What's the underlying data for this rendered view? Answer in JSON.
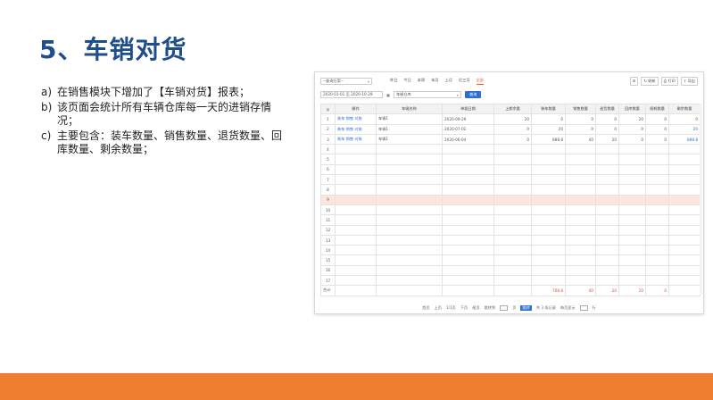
{
  "slide": {
    "title": "5、车销对货",
    "bullets": [
      {
        "marker": "a)",
        "text": "在销售模块下增加了【车销对货】报表；"
      },
      {
        "marker": "b)",
        "text": "该页面会统计所有车辆仓库每一天的进销存情况；"
      },
      {
        "marker": "c)",
        "text": "主要包含：装车数量、销售数量、退货数量、回库数量、剩余数量；"
      }
    ]
  },
  "app": {
    "query_scheme": "--查询方案--",
    "quick_ranges": [
      "昨日",
      "今日",
      "本周",
      "本月",
      "上月",
      "近三月",
      "全部"
    ],
    "active_range": "全部",
    "toolbar_buttons": [
      "刷新",
      "打印",
      "导出"
    ],
    "date_range": "2020-01-01 至 2020-10-29",
    "warehouse_placeholder": "车辆仓库",
    "query_button": "查询",
    "columns": [
      "",
      "操作",
      "车辆名称",
      "单据日期",
      "上期余量",
      "装车数量",
      "销售数量",
      "退货数量",
      "回库数量",
      "损耗数量",
      "剩余数量"
    ],
    "rows": [
      {
        "no": "1",
        "ops": "装车 销售 对账",
        "vehicle": "车辆1",
        "date": "2020-09-29",
        "prev": "20",
        "load": "0",
        "sale": "0",
        "ret": "0",
        "back": "20",
        "loss": "0",
        "left": "0",
        "left_link": false
      },
      {
        "no": "2",
        "ops": "装车 销售 对账",
        "vehicle": "车辆1",
        "date": "2020-07-02",
        "prev": "0",
        "load": "20",
        "sale": "0",
        "ret": "0",
        "back": "0",
        "loss": "0",
        "left": "20",
        "left_link": true
      },
      {
        "no": "3",
        "ops": "装车 销售 对账",
        "vehicle": "车辆1",
        "date": "2020-06-04",
        "prev": "0",
        "load": "888.8",
        "sale": "40",
        "ret": "20",
        "back": "0",
        "loss": "0",
        "left": "888.8",
        "left_link": true
      }
    ],
    "empty_rows": [
      "4",
      "5",
      "6",
      "7",
      "8",
      "9",
      "10",
      "11",
      "12",
      "13",
      "14",
      "15",
      "16",
      "17"
    ],
    "highlight_row": "9",
    "total_label": "合计",
    "totals": {
      "load": "708.8",
      "sale": "40",
      "ret": "20",
      "back": "20",
      "loss": "0"
    },
    "pager": {
      "first": "首页",
      "prev": "上页",
      "page_info": "1/1页",
      "next": "下页",
      "last": "尾页",
      "jump_label": "跳转到",
      "page_unit": "页",
      "go": "跳转",
      "record_info": "共 3 条记录",
      "per_page_label": "每页显示",
      "per_page_unit": "行"
    }
  },
  "colors": {
    "title": "#1f4e8c",
    "footer": "#ee7d30",
    "accent": "#2b6fd6"
  }
}
